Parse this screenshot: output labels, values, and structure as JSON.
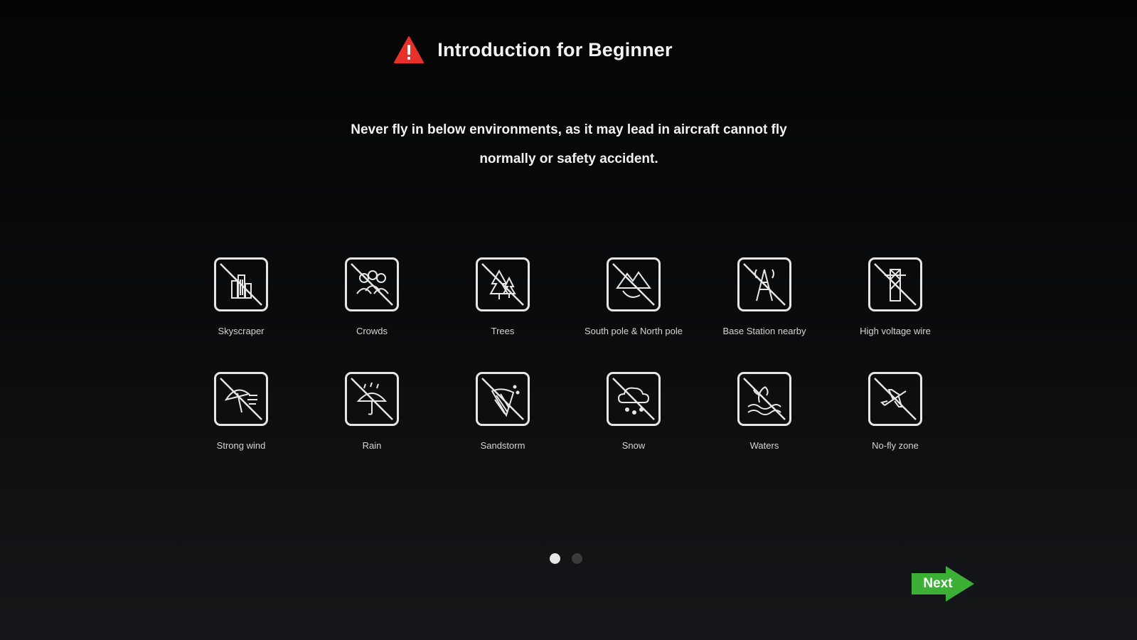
{
  "header": {
    "title": "Introduction for Beginner",
    "icon": "warning-triangle-icon",
    "icon_color": "#e8312b"
  },
  "message": {
    "line1": "Never fly in below environments, as it may lead in aircraft cannot fly",
    "line2": "normally or safety accident."
  },
  "hazards": [
    {
      "label": "Skyscraper",
      "icon": "skyscraper-icon"
    },
    {
      "label": "Crowds",
      "icon": "crowds-icon"
    },
    {
      "label": "Trees",
      "icon": "trees-icon"
    },
    {
      "label": "South pole & North pole",
      "icon": "mountain-pole-icon"
    },
    {
      "label": "Base Station nearby",
      "icon": "base-station-icon"
    },
    {
      "label": "High voltage wire",
      "icon": "high-voltage-tower-icon"
    },
    {
      "label": "Strong wind",
      "icon": "strong-wind-icon"
    },
    {
      "label": "Rain",
      "icon": "rain-icon"
    },
    {
      "label": "Sandstorm",
      "icon": "sandstorm-icon"
    },
    {
      "label": "Snow",
      "icon": "snow-icon"
    },
    {
      "label": "Waters",
      "icon": "waters-icon"
    },
    {
      "label": "No-fly zone",
      "icon": "no-fly-zone-icon"
    }
  ],
  "pagination": {
    "current": 1,
    "total": 2
  },
  "next_button": {
    "label": "Next",
    "color": "#3cb034"
  }
}
